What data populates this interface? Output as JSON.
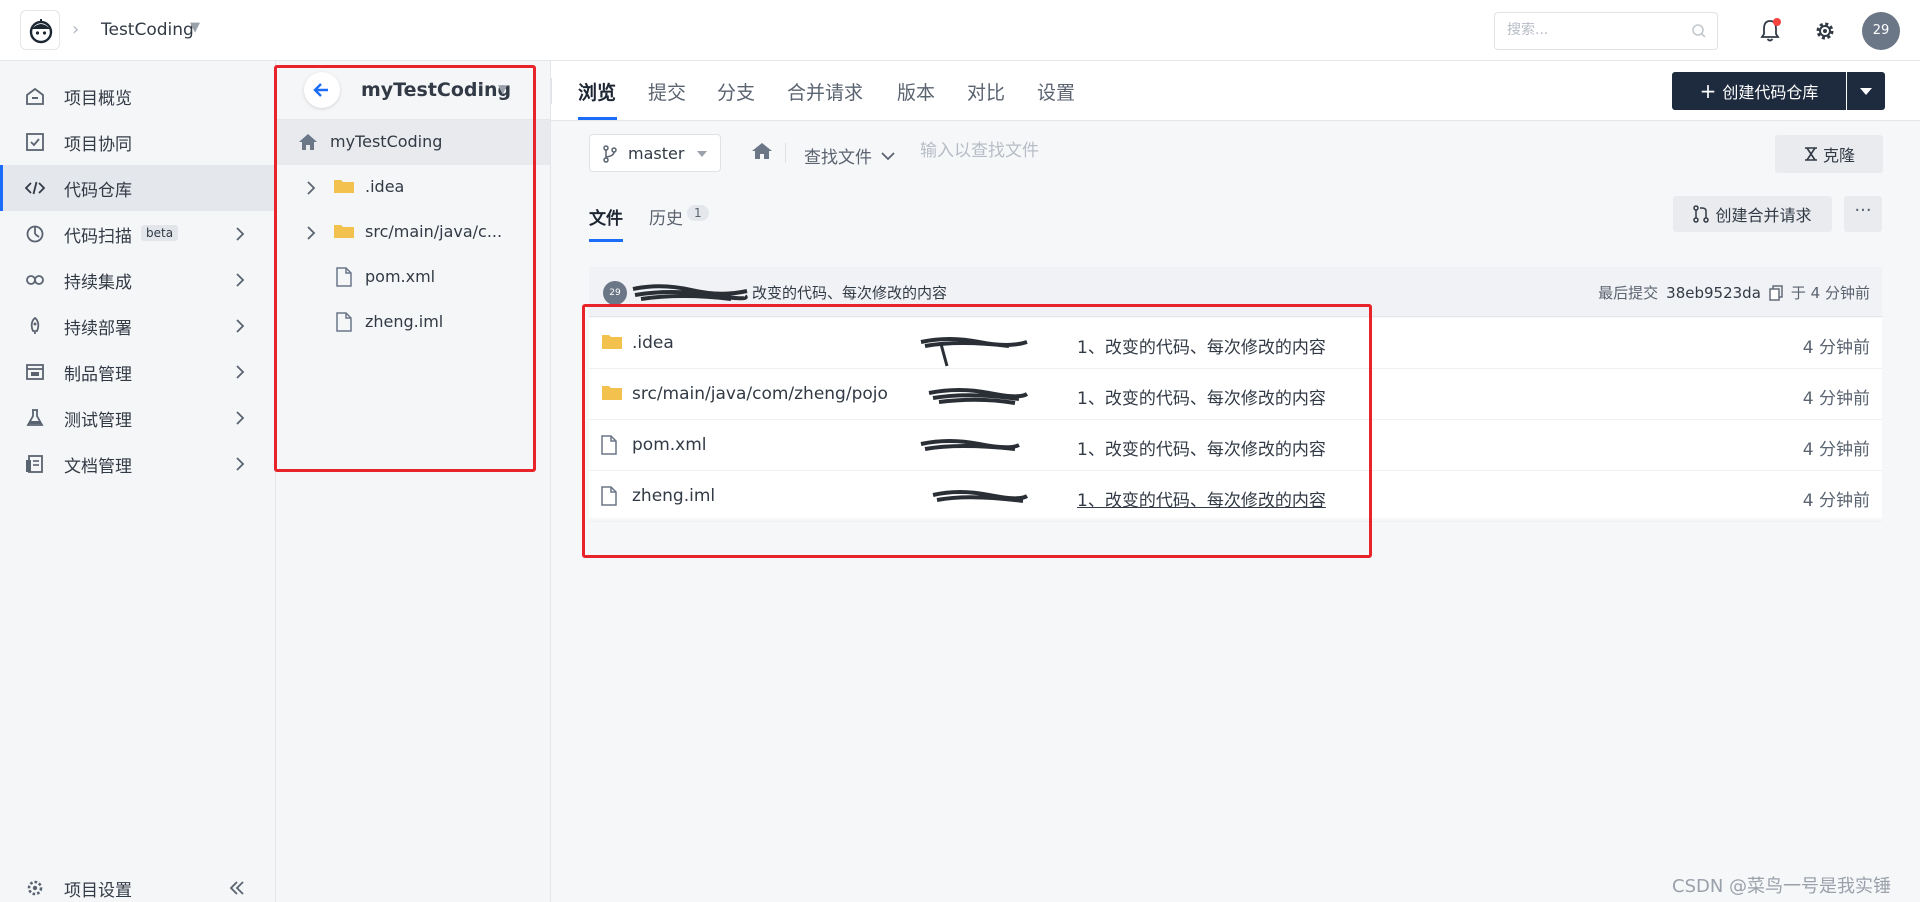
{
  "topbar": {
    "project_name": "TestCoding",
    "search_placeholder": "搜索...",
    "avatar_text": "29"
  },
  "leftnav": {
    "items": [
      {
        "label": "项目概览"
      },
      {
        "label": "项目协同"
      },
      {
        "label": "代码仓库",
        "active": true
      },
      {
        "label": "代码扫描",
        "badge": "beta"
      },
      {
        "label": "持续集成"
      },
      {
        "label": "持续部署"
      },
      {
        "label": "制品管理"
      },
      {
        "label": "测试管理"
      },
      {
        "label": "文档管理"
      }
    ],
    "settings_label": "项目设置"
  },
  "tree": {
    "repo_title": "myTestCoding",
    "root_label": "myTestCoding",
    "items": [
      {
        "label": ".idea",
        "type": "folder"
      },
      {
        "label": "src/main/java/c...",
        "type": "folder"
      },
      {
        "label": "pom.xml",
        "type": "file"
      },
      {
        "label": "zheng.iml",
        "type": "file"
      }
    ]
  },
  "main": {
    "tabs": [
      "浏览",
      "提交",
      "分支",
      "合并请求",
      "版本",
      "对比",
      "设置"
    ],
    "create_repo_label": "创建代码仓库",
    "branch": "master",
    "find_label": "查找文件",
    "find_placeholder": "输入以查找文件",
    "clone_label": "克隆",
    "subtabs": {
      "files": "文件",
      "history": "历史",
      "history_count": "1"
    },
    "create_mr_label": "创建合并请求",
    "commit": {
      "avatar_text": "29",
      "message": "改变的代码、每次修改的内容",
      "last_commit_label": "最后提交",
      "hash": "38eb9523da",
      "time": "于 4 分钟前"
    },
    "files": [
      {
        "name": ".idea",
        "type": "folder",
        "message": "1、改变的代码、每次修改的内容",
        "time": "4 分钟前"
      },
      {
        "name": "src/main/java/com/zheng/pojo",
        "type": "folder",
        "message": "1、改变的代码、每次修改的内容",
        "time": "4 分钟前"
      },
      {
        "name": "pom.xml",
        "type": "file",
        "message": "1、改变的代码、每次修改的内容",
        "time": "4 分钟前"
      },
      {
        "name": "zheng.iml",
        "type": "file",
        "message": "1、改变的代码、每次修改的内容",
        "time": "4 分钟前"
      }
    ]
  },
  "watermark": "CSDN @菜鸟一号是我实锤",
  "colors": {
    "accent": "#1b6cf6",
    "annotation": "#e8232a",
    "dark_button": "#1e2a3d",
    "folder": "#f2c14e"
  }
}
